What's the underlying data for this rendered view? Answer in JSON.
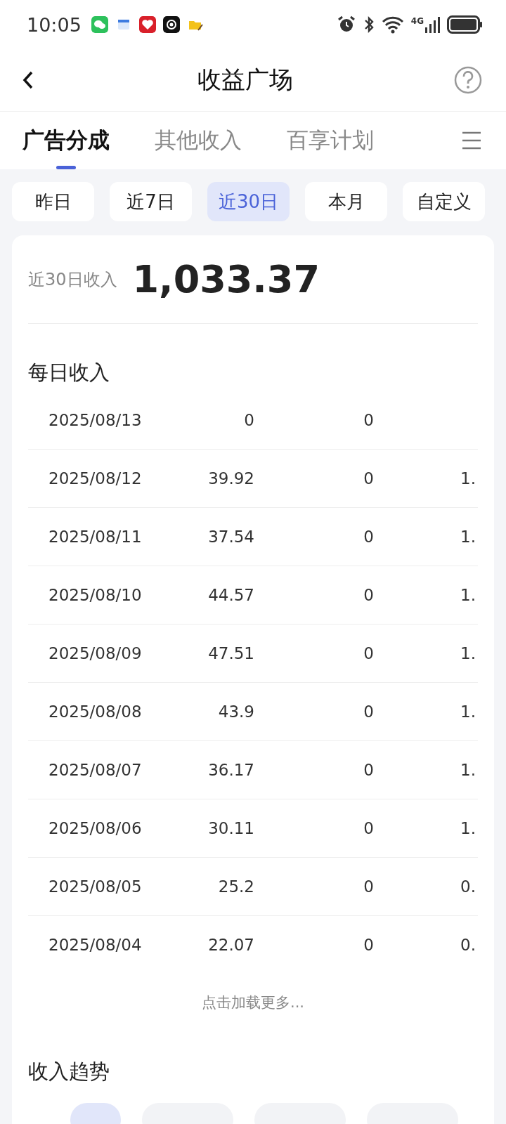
{
  "status_bar": {
    "time": "10:05",
    "network": "4G"
  },
  "header": {
    "title": "收益广场"
  },
  "tabs": [
    {
      "label": "广告分成",
      "selected": true
    },
    {
      "label": "其他收入",
      "selected": false
    },
    {
      "label": "百享计划",
      "selected": false
    }
  ],
  "periods": [
    {
      "label": "昨日",
      "selected": false
    },
    {
      "label": "近7日",
      "selected": false
    },
    {
      "label": "近30日",
      "selected": true
    },
    {
      "label": "本月",
      "selected": false
    },
    {
      "label": "自定义",
      "selected": false
    }
  ],
  "summary": {
    "label": "近30日收入",
    "amount": "1,033.37"
  },
  "daily": {
    "title": "每日收入",
    "rows": [
      [
        "2025/08/13",
        "0",
        "0",
        ""
      ],
      [
        "2025/08/12",
        "39.92",
        "0",
        "1."
      ],
      [
        "2025/08/11",
        "37.54",
        "0",
        "1."
      ],
      [
        "2025/08/10",
        "44.57",
        "0",
        "1."
      ],
      [
        "2025/08/09",
        "47.51",
        "0",
        "1."
      ],
      [
        "2025/08/08",
        "43.9",
        "0",
        "1."
      ],
      [
        "2025/08/07",
        "36.17",
        "0",
        "1."
      ],
      [
        "2025/08/06",
        "30.11",
        "0",
        "1."
      ],
      [
        "2025/08/05",
        "25.2",
        "0",
        "0."
      ],
      [
        "2025/08/04",
        "22.07",
        "0",
        "0."
      ]
    ],
    "load_more": "点击加载更多..."
  },
  "trend": {
    "title": "收入趋势",
    "filters": [
      {
        "selected": true
      },
      {
        "selected": false
      },
      {
        "selected": false
      },
      {
        "selected": false
      }
    ]
  }
}
